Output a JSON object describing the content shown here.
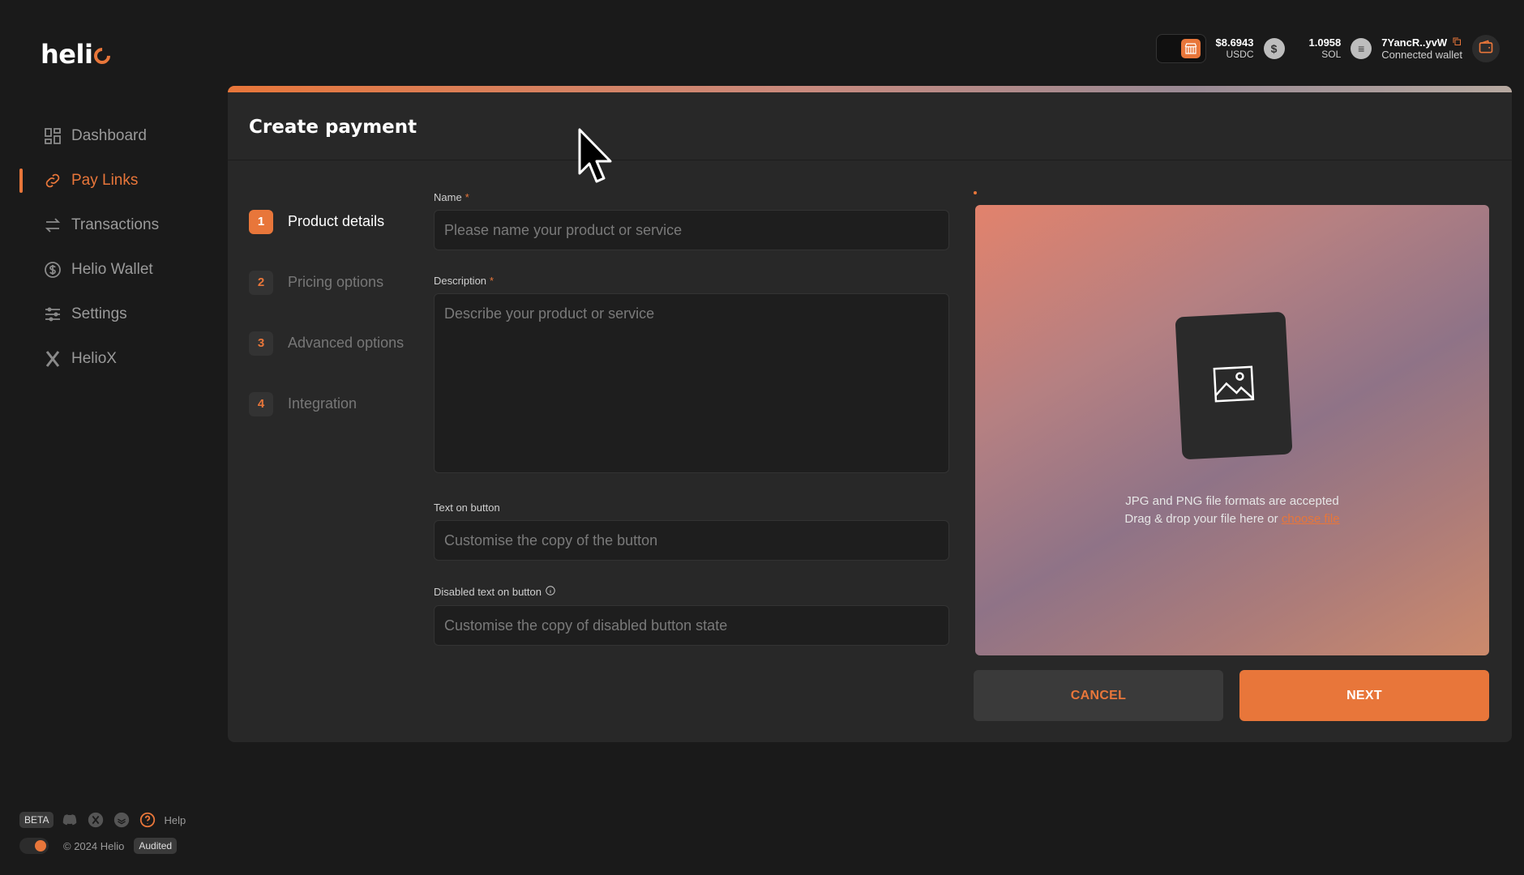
{
  "brand": {
    "logo_text": "heli",
    "accent": "#e8763a"
  },
  "sidebar": {
    "items": [
      {
        "label": "Dashboard",
        "icon": "dashboard-icon",
        "active": false
      },
      {
        "label": "Pay Links",
        "icon": "link-icon",
        "active": true
      },
      {
        "label": "Transactions",
        "icon": "transfer-icon",
        "active": false
      },
      {
        "label": "Helio Wallet",
        "icon": "dollar-icon",
        "active": false
      },
      {
        "label": "Settings",
        "icon": "sliders-icon",
        "active": false
      },
      {
        "label": "HelioX",
        "icon": "x-logo-icon",
        "active": false
      }
    ]
  },
  "footer": {
    "beta": "BETA",
    "help": "Help",
    "copyright": "© 2024 Helio",
    "audited": "Audited"
  },
  "topbar": {
    "usdc_amount": "$8.6943",
    "usdc_label": "USDC",
    "sol_amount": "1.0958",
    "sol_label": "SOL",
    "wallet_address": "7YancR..yvW",
    "wallet_label": "Connected wallet"
  },
  "panel": {
    "title": "Create payment",
    "steps": [
      {
        "num": "1",
        "label": "Product details",
        "active": true
      },
      {
        "num": "2",
        "label": "Pricing options",
        "active": false
      },
      {
        "num": "3",
        "label": "Advanced options",
        "active": false
      },
      {
        "num": "4",
        "label": "Integration",
        "active": false
      }
    ],
    "form": {
      "name_label": "Name",
      "name_placeholder": "Please name your product or service",
      "description_label": "Description",
      "description_placeholder": "Describe your product or service",
      "button_text_label": "Text on button",
      "button_text_placeholder": "Customise the copy of the button",
      "disabled_text_label": "Disabled text on button",
      "disabled_text_placeholder": "Customise the copy of disabled button state",
      "required_mark": "*"
    },
    "upload": {
      "formats": "JPG and PNG file formats are accepted",
      "drag_text": "Drag & drop your file here or",
      "choose_link": "choose file"
    },
    "actions": {
      "cancel": "CANCEL",
      "next": "NEXT"
    }
  }
}
